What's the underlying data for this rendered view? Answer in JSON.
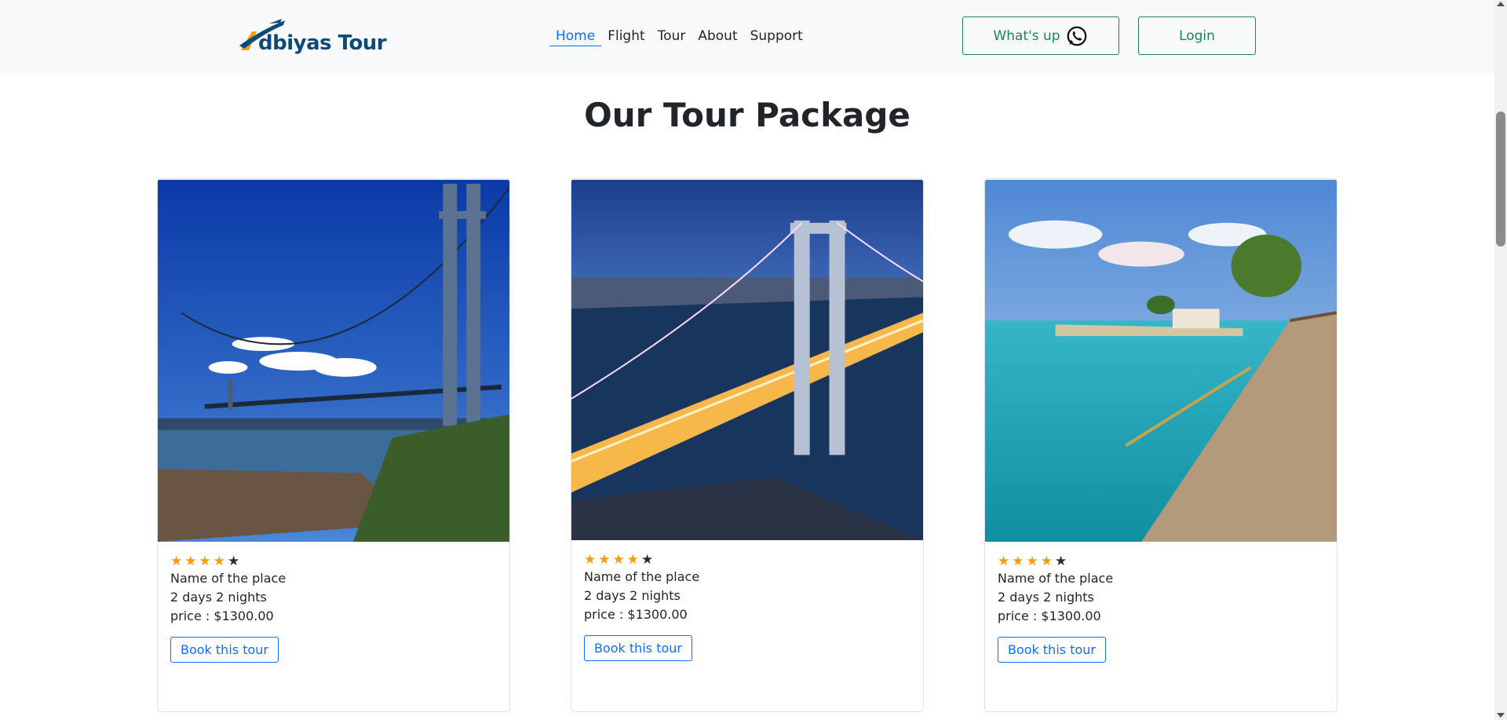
{
  "brand": {
    "name": "Adbiyas Tour",
    "logo_text": "dbiyas Tour",
    "color": "#0d4a78",
    "accent": "#f59e0b"
  },
  "nav": {
    "items": [
      {
        "label": "Home",
        "active": true
      },
      {
        "label": "Flight",
        "active": false
      },
      {
        "label": "Tour",
        "active": false
      },
      {
        "label": "About",
        "active": false
      },
      {
        "label": "Support",
        "active": false
      }
    ],
    "whatsapp_label": "What's up",
    "whatsapp_icon": "whatsapp-icon",
    "login_label": "Login"
  },
  "section": {
    "title": "Our Tour Package"
  },
  "cards": [
    {
      "image": "bridge-daytime-photo",
      "rating": 4,
      "max_rating": 5,
      "name": "Name of the place",
      "duration": "2 days 2 nights",
      "price": "price : $1300.00",
      "button": "Book this tour"
    },
    {
      "image": "bridge-night-photo",
      "rating": 4,
      "max_rating": 5,
      "name": "Name of the place",
      "duration": "2 days 2 nights",
      "price": "price : $1300.00",
      "button": "Book this tour"
    },
    {
      "image": "tropical-beach-photo",
      "rating": 4,
      "max_rating": 5,
      "name": "Name of the place",
      "duration": "2 days 2 nights",
      "price": "price : $1300.00",
      "button": "Book this tour"
    }
  ],
  "colors": {
    "primary": "#0d6efd",
    "success": "#198754",
    "navbar_bg": "#f8f9fa",
    "star": "#f59e0b"
  }
}
